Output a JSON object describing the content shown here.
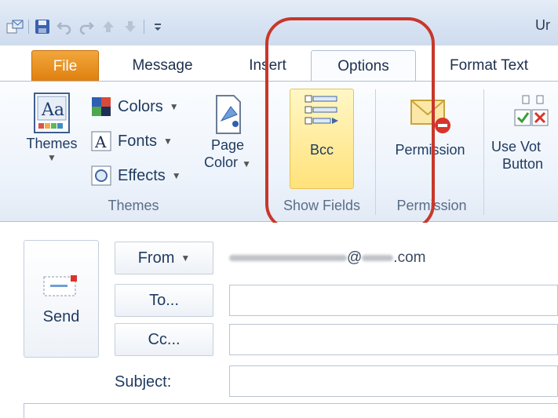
{
  "window": {
    "title": "Ur"
  },
  "tabs": {
    "file": "File",
    "message": "Message",
    "insert": "Insert",
    "options": "Options",
    "format_text": "Format Text"
  },
  "ribbon": {
    "themes_group": {
      "themes_button": "Themes",
      "colors": "Colors",
      "fonts": "Fonts",
      "effects": "Effects",
      "page_color_line1": "Page",
      "page_color_line2": "Color",
      "label": "Themes"
    },
    "show_fields_group": {
      "bcc_button": "Bcc",
      "label": "Show Fields"
    },
    "permission_group": {
      "permission_button": "Permission",
      "label": "Permission"
    },
    "tracking_group": {
      "voting_line1": "Use Vot",
      "voting_line2": "Button"
    }
  },
  "compose": {
    "send": "Send",
    "from_button": "From",
    "to_button": "To...",
    "cc_button": "Cc...",
    "subject_label": "Subject:",
    "from_value_at": "@",
    "from_value_suffix": ".com",
    "to_value": "",
    "cc_value": "",
    "subject_value": ""
  },
  "icons": {
    "qat": [
      "outlook-icon",
      "save-icon",
      "undo-icon",
      "redo-icon",
      "up-arrow-icon",
      "down-arrow-icon",
      "customize-qat-icon"
    ]
  },
  "annotation": {
    "highlight_color": "#c8372a"
  }
}
